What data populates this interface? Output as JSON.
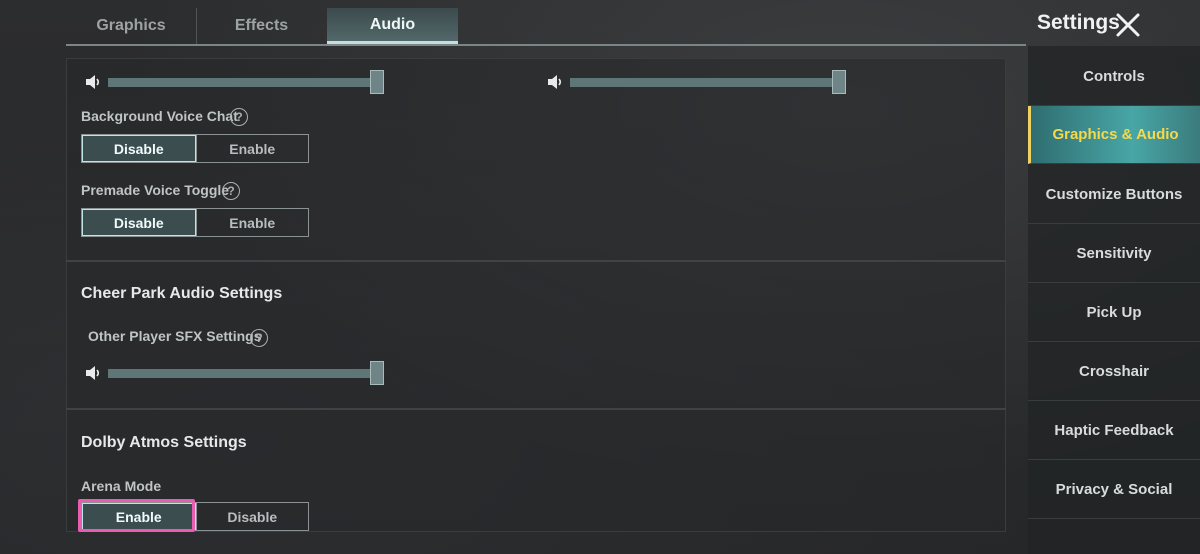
{
  "header": {
    "title": "Settings"
  },
  "tabs": [
    {
      "label": "Graphics",
      "active": false
    },
    {
      "label": "Effects",
      "active": false
    },
    {
      "label": "Audio",
      "active": true
    }
  ],
  "audio": {
    "top_sliders": [
      {
        "value": 1.0
      },
      {
        "value": 1.0
      }
    ],
    "background_voice_chat": {
      "label": "Background Voice Chat",
      "options": [
        "Disable",
        "Enable"
      ],
      "selected": "Disable"
    },
    "premade_voice_toggle": {
      "label": "Premade Voice Toggle",
      "options": [
        "Disable",
        "Enable"
      ],
      "selected": "Disable"
    },
    "cheer_park": {
      "title": "Cheer Park Audio Settings",
      "sfx_label": "Other Player SFX Settings",
      "sfx_slider": {
        "value": 1.0
      }
    },
    "dolby": {
      "title": "Dolby Atmos Settings",
      "arena_label": "Arena Mode",
      "options": [
        "Enable",
        "Disable"
      ],
      "selected": "Enable"
    },
    "help_glyph": "?"
  },
  "sidebar": {
    "items": [
      {
        "label": "Controls",
        "active": false
      },
      {
        "label": "Graphics & Audio",
        "active": true
      },
      {
        "label": "Customize Buttons",
        "active": false
      },
      {
        "label": "Sensitivity",
        "active": false
      },
      {
        "label": "Pick Up",
        "active": false
      },
      {
        "label": "Crosshair",
        "active": false
      },
      {
        "label": "Haptic Feedback",
        "active": false
      },
      {
        "label": "Privacy & Social",
        "active": false
      }
    ]
  },
  "colors": {
    "accent_teal": "#3b4d4f",
    "active_sidebar_text": "#f5d94a",
    "highlight": "#e85cb2"
  }
}
